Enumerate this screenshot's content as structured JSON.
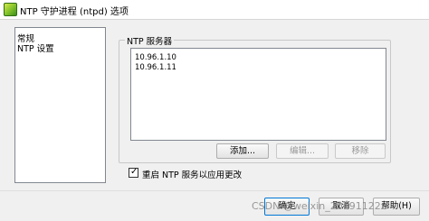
{
  "window": {
    "title": "NTP 守护进程 (ntpd) 选项",
    "icon": "app-icon"
  },
  "nav": {
    "items": [
      {
        "label": "常规"
      },
      {
        "label": "NTP 设置"
      }
    ]
  },
  "ntp_servers": {
    "group_label": "NTP 服务器",
    "servers": [
      "10.96.1.10",
      "10.96.1.11"
    ],
    "add_label": "添加...",
    "edit_label": "编辑...",
    "remove_label": "移除"
  },
  "restart_option": {
    "label": "重启 NTP 服务以应用更改",
    "checked": true
  },
  "footer": {
    "ok_label": "确定",
    "cancel_label": "取消",
    "help_label": "帮助(H)"
  },
  "watermark": {
    "text": "CSDN @weixin_20191122z"
  },
  "colors": {
    "dialog_bg": "#f0f0f0",
    "default_button_border": "#0078d7"
  }
}
